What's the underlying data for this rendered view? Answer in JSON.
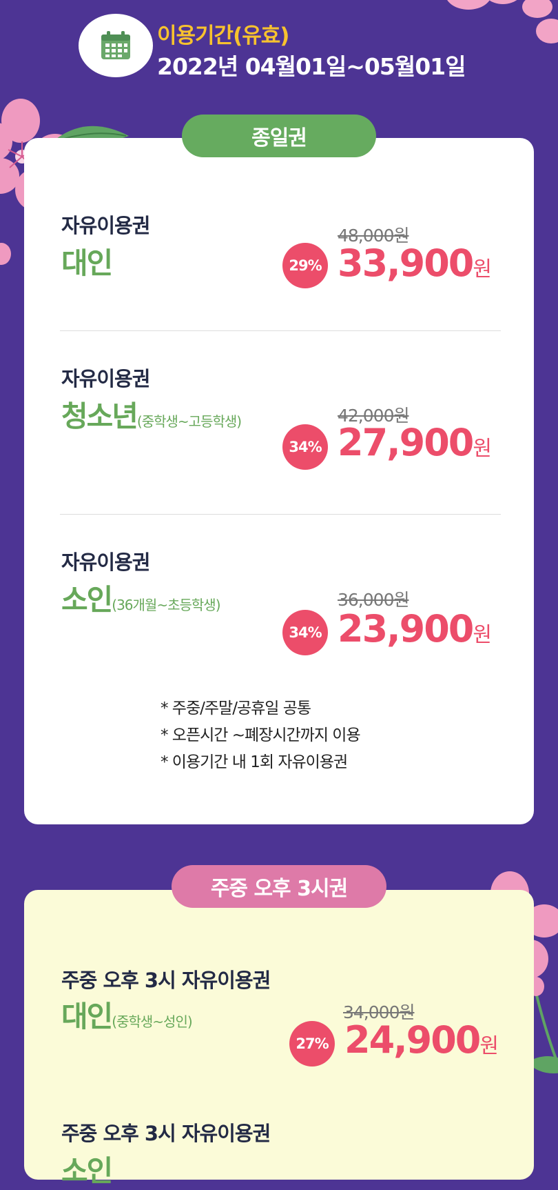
{
  "header": {
    "icon": "calendar-icon",
    "period_label": "이용기간(유효)",
    "period_dates": "2022년 04월01일~05월01일"
  },
  "sections": [
    {
      "title": "종일권",
      "items": [
        {
          "type": "자유이용권",
          "name": "대인",
          "sub": "",
          "original": "48,000원",
          "discount": "29%",
          "price": "33,900",
          "unit": "원"
        },
        {
          "type": "자유이용권",
          "name": "청소년",
          "sub": "(중학생~고등학생)",
          "original": "42,000원",
          "discount": "34%",
          "price": "27,900",
          "unit": "원"
        },
        {
          "type": "자유이용권",
          "name": "소인",
          "sub": "(36개월~초등학생)",
          "original": "36,000원",
          "discount": "34%",
          "price": "23,900",
          "unit": "원"
        }
      ],
      "notes": [
        "* 주중/주말/공휴일 공통",
        "* 오픈시간 ~폐장시간까지 이용",
        "* 이용기간 내 1회 자유이용권"
      ]
    },
    {
      "title": "주중 오후 3시권",
      "items": [
        {
          "type": "주중 오후 3시 자유이용권",
          "name": "대인",
          "sub": "(중학생~성인)",
          "original": "34,000원",
          "discount": "27%",
          "price": "24,900",
          "unit": "원"
        },
        {
          "type": "주중 오후 3시 자유이용권",
          "name": "소인",
          "sub": "",
          "original": "",
          "discount": "",
          "price": "",
          "unit": ""
        }
      ]
    }
  ],
  "colors": {
    "background": "#4d3494",
    "accent_green": "#66ab5f",
    "accent_pink": "#de7aa8",
    "price_red": "#ec4d6a",
    "yellow_text": "#f7c22e"
  }
}
